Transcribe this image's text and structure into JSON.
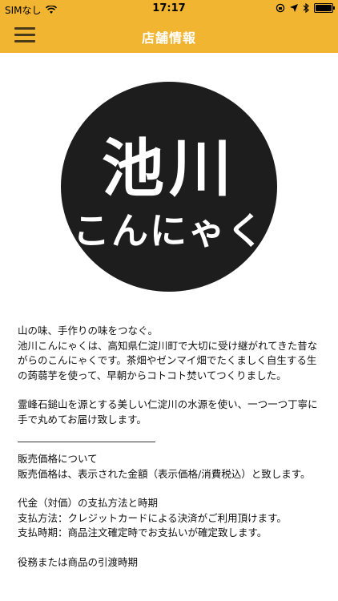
{
  "status_bar": {
    "carrier": "SIMなし",
    "time": "17:17"
  },
  "nav": {
    "title": "店舗情報"
  },
  "logo": {
    "kanji": "池川",
    "kana": "こんにゃく"
  },
  "content": {
    "intro_lines": [
      "山の味、手作りの味をつなぐ。",
      "池川こんにゃくは、高知県仁淀川町で大切に受け継がれてきた昔ながらのこんにゃくです。茶畑やゼンマイ畑でたくましく自生する生の蒟蒻芋を使って、早朝からコトコト焚いてつくりました。"
    ],
    "water_paragraph": "霊峰石鎚山を源とする美しい仁淀川の水源を使い、一つ一つ丁寧に手で丸めてお届け致します。",
    "price_heading": "販売価格について",
    "price_text": "販売価格は、表示された金額（表示価格/消費税込）と致します。",
    "payment_heading": "代金（対価）の支払方法と時期",
    "payment_method": "支払方法：クレジットカードによる決済がご利用頂けます。",
    "payment_timing": "支払時期：商品注文確定時でお支払いが確定致します。",
    "delivery_heading": "役務または商品の引渡時期"
  }
}
